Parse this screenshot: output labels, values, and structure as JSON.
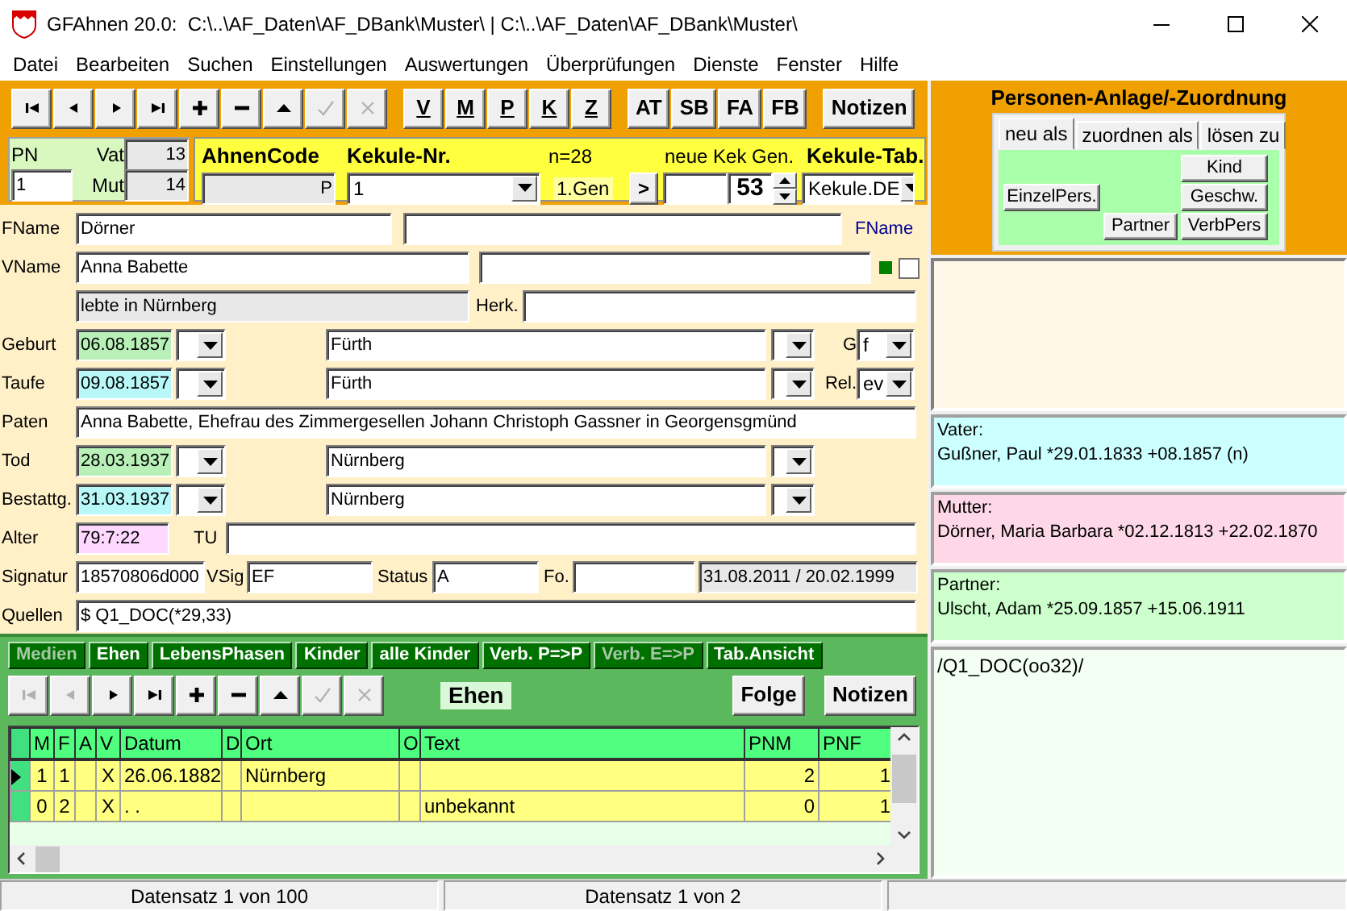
{
  "window": {
    "title": "GFAhnen 20.0:  C:\\..\\AF_Daten\\AF_DBank\\Muster\\ | C:\\..\\AF_Daten\\AF_DBank\\Muster\\"
  },
  "menu": [
    "Datei",
    "Bearbeiten",
    "Suchen",
    "Einstellungen",
    "Auswertungen",
    "Überprüfungen",
    "Dienste",
    "Fenster",
    "Hilfe"
  ],
  "toolbar": {
    "nav": [
      {
        "kind": "first",
        "disabled": false
      },
      {
        "kind": "prev",
        "disabled": false
      },
      {
        "kind": "next",
        "disabled": false
      },
      {
        "kind": "last",
        "disabled": false
      },
      {
        "kind": "add",
        "disabled": false
      },
      {
        "kind": "remove",
        "disabled": false
      },
      {
        "kind": "up",
        "disabled": false
      },
      {
        "kind": "confirm",
        "disabled": true
      },
      {
        "kind": "cancel",
        "disabled": true
      }
    ],
    "relations": [
      "V",
      "M",
      "P",
      "K",
      "Z"
    ],
    "views": [
      "AT",
      "SB",
      "FA",
      "FB"
    ],
    "notes": "Notizen"
  },
  "record_header": {
    "pn_label": "PN",
    "pn_value": "1",
    "vat_label": "Vat",
    "vat_value": "13",
    "mut_label": "Mut",
    "mut_value": "14",
    "ahnencode_label": "AhnenCode",
    "ahnencode_value": "P",
    "kekule_label": "Kekule-Nr.",
    "kekule_value": "1",
    "count": "n=28",
    "generation": "1.Gen",
    "go_button": ">",
    "new_gen_label": "neue Kek Gen.",
    "gen_value": "53",
    "table_label": "Kekule-Tab.",
    "table_value": "Kekule.DE"
  },
  "person": {
    "fname_label": "FName",
    "fname": "Dörner",
    "fname_link": "FName",
    "vname_label": "VName",
    "vname": "Anna Babette",
    "flag_checked": false,
    "residence": "lebte in Nürnberg",
    "herk_label": "Herk.",
    "paten_label": "Paten",
    "paten": "Anna Babette, Ehefrau des Zimmergesellen Johann Christoph Gassner in Georgensgmünd",
    "alter_label": "Alter",
    "alter": "79:7:22",
    "tu_label": "TU",
    "signatur_label": "Signatur",
    "signatur": "18570806d000",
    "vsig_label": "VSig",
    "vsig": "EF",
    "status_label": "Status",
    "status": "A",
    "fo_label": "Fo.",
    "dates": "31.08.2011 / 20.02.1999",
    "quellen_label": "Quellen",
    "quellen": "$ Q1_DOC(*29,33)"
  },
  "events": [
    {
      "label": "Geburt",
      "date": "06.08.1857",
      "color": "#b8f0b8",
      "place": "Fürth",
      "side_label": "G",
      "side_value": "f"
    },
    {
      "label": "Taufe",
      "date": "09.08.1857",
      "color": "#b8f8f8",
      "place": "Fürth",
      "side_label": "Rel.",
      "side_value": "ev"
    },
    {
      "label": "Tod",
      "date": "28.03.1937",
      "color": "#b8f0b8",
      "place": "Nürnberg"
    },
    {
      "label": "Bestattg.",
      "date": "31.03.1937",
      "color": "#b8f8f8",
      "place": "Nürnberg"
    }
  ],
  "sub_tabs": [
    {
      "label": "Medien",
      "disabled": true
    },
    {
      "label": "Ehen",
      "disabled": false
    },
    {
      "label": "LebensPhasen",
      "disabled": false
    },
    {
      "label": "Kinder",
      "disabled": false
    },
    {
      "label": "alle Kinder",
      "disabled": false
    },
    {
      "label": "Verb. P=>P",
      "disabled": false
    },
    {
      "label": "Verb. E=>P",
      "disabled": true
    },
    {
      "label": "Tab.Ansicht",
      "disabled": false
    }
  ],
  "sub_toolbar": {
    "nav": [
      {
        "kind": "first",
        "disabled": true
      },
      {
        "kind": "prev",
        "disabled": true
      },
      {
        "kind": "next",
        "disabled": false
      },
      {
        "kind": "last",
        "disabled": false
      },
      {
        "kind": "add",
        "disabled": false
      },
      {
        "kind": "remove",
        "disabled": false
      },
      {
        "kind": "up",
        "disabled": false
      },
      {
        "kind": "confirm",
        "disabled": true
      },
      {
        "kind": "cancel",
        "disabled": true
      }
    ],
    "title": "Ehen",
    "order_button": "Folge",
    "notes_button": "Notizen"
  },
  "table": {
    "columns": [
      "M",
      "F",
      "A",
      "V",
      "Datum",
      "D",
      "Ort",
      "O",
      "Text",
      "PNM",
      "PNF"
    ],
    "rows": [
      {
        "current": true,
        "cells": [
          "1",
          "1",
          null,
          "X",
          "26.06.1882",
          null,
          "Nürnberg",
          null,
          null,
          "2",
          "1"
        ]
      },
      {
        "current": false,
        "cells": [
          "0",
          "2",
          null,
          "X",
          ". .",
          null,
          null,
          null,
          "unbekannt",
          "0",
          "1"
        ]
      }
    ]
  },
  "status_bar": [
    "Datensatz 1 von 100",
    "Datensatz 1 von 2"
  ],
  "person_panel": {
    "title": "Personen-Anlage/-Zuordnung",
    "tabs": [
      {
        "label": "neu als",
        "selected": true
      },
      {
        "label": "zuordnen als",
        "selected": false
      },
      {
        "label": "lösen zu",
        "selected": false
      }
    ],
    "kind_button": "Kind",
    "single_button": "EinzelPers.",
    "sibling_button": "Geschw.",
    "partner_button": "Partner",
    "linked_button": "VerbPers"
  },
  "relations": [
    {
      "label": "Vater:",
      "text": "Gußner, Paul *29.01.1833 +08.1857 (n)",
      "color": "#ccffff"
    },
    {
      "label": "Mutter:",
      "text": "Dörner, Maria Barbara *02.12.1813 +22.02.1870",
      "color": "#ffd8e8"
    },
    {
      "label": "Partner:",
      "text": "Ulscht, Adam *25.09.1857 +15.06.1911",
      "color": "#ccffcc"
    }
  ],
  "source_note": "/Q1_DOC(oo32)/"
}
